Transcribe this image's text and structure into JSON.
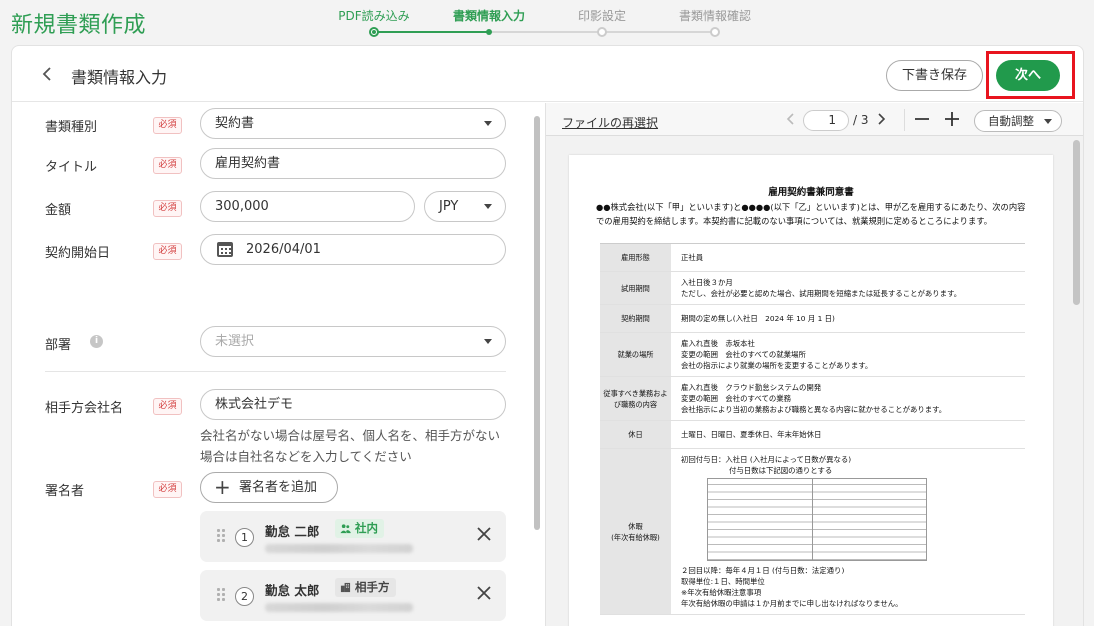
{
  "app": {
    "title": "新規書類作成"
  },
  "steps": [
    {
      "label": "PDF読み込み",
      "state": "done"
    },
    {
      "label": "書類情報入力",
      "state": "active"
    },
    {
      "label": "印影設定",
      "state": "pending"
    },
    {
      "label": "書類情報確認",
      "state": "pending"
    }
  ],
  "header": {
    "back_icon": "chevron-left-icon",
    "title": "書類情報入力",
    "draft_label": "下書き保存",
    "next_label": "次へ",
    "highlight_color": "#e8141e"
  },
  "form": {
    "required_badge": "必須",
    "doc_type": {
      "label": "書類種別",
      "value": "契約書"
    },
    "title": {
      "label": "タイトル",
      "value": "雇用契約書"
    },
    "amount": {
      "label": "金額",
      "value": "300,000",
      "currency": "JPY"
    },
    "start_date": {
      "label": "契約開始日",
      "value": "2026/04/01"
    },
    "department": {
      "label": "部署",
      "placeholder": "未選択"
    },
    "partner": {
      "label": "相手方会社名",
      "value": "株式会社デモ",
      "hint": "会社名がない場合は屋号名、個人名を、相手方がない場合は自社名などを入力してください"
    },
    "signers": {
      "label": "署名者",
      "add_label": "署名者を追加",
      "items": [
        {
          "index": "1",
          "name": "勤怠 二郎",
          "tag": "社内"
        },
        {
          "index": "2",
          "name": "勤怠 太郎",
          "tag": "相手方"
        }
      ]
    }
  },
  "preview": {
    "reselect_label": "ファイルの再選択",
    "page_current": "1",
    "page_total": "/ 3",
    "zoom_label": "自動調整",
    "document": {
      "title": "雇用契約書兼同意書",
      "intro": "●●株式会社(以下「甲」といいます)と●●●●(以下「乙」といいます)とは、甲が乙を雇用するにあたり、次の内容での雇用契約を締結します。本契約書に記載のない事項については、就業規則に定めるところによります。",
      "rows": [
        {
          "head": "雇用形態",
          "lines": [
            "正社員"
          ]
        },
        {
          "head": "試用期間",
          "lines": [
            "入社日後３か月",
            "ただし、会社が必要と認めた場合、試用期間を短縮または延長することがあります。"
          ]
        },
        {
          "head": "契約期間",
          "lines": [
            "期間の定め無し(入社日　2024 年 10 月 1 日)"
          ]
        },
        {
          "head": "就業の場所",
          "lines": [
            "雇入れ直後　赤坂本社",
            "変更の範囲　会社のすべての就業場所",
            "会社の指示により就業の場所を変更することがあります。"
          ]
        },
        {
          "head": "従事すべき業務および職務の内容",
          "lines": [
            "雇入れ直後　クラウド勤怠システムの開発",
            "変更の範囲　会社のすべての業務",
            "会社指示により当初の業務および職務と異なる内容に就かせることがあります。"
          ]
        },
        {
          "head": "休日",
          "lines": [
            "土曜日、日曜日、夏季休日、年末年始休日"
          ]
        }
      ],
      "leave": {
        "head": "休暇\n(年次有給休暇)",
        "first": "初回付与日：入社日 (入社月によって日数が異なる)",
        "first_sub": "付与日数は下記図の通りとする",
        "after": [
          "２回目以降：毎年４月１日 (付与日数：法定通り)",
          "取得単位:１日、時間単位",
          "※年次有給休暇注意事項",
          "年次有給休暇の申請は１か月前までに申し出なければなりません。"
        ]
      }
    }
  }
}
